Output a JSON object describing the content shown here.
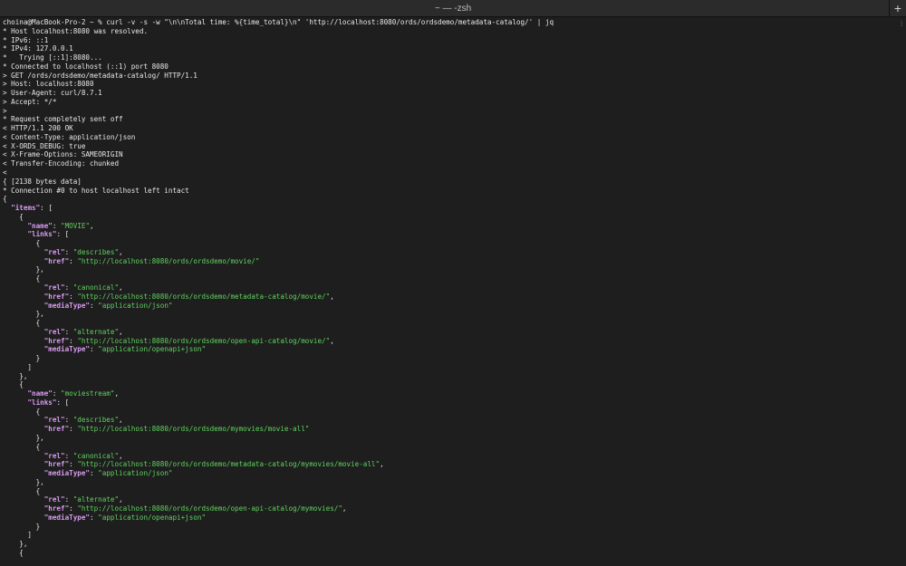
{
  "window": {
    "title": "~ — -zsh",
    "new_tab_symbol": "+"
  },
  "terminal": {
    "lines": [
      "choina@MacBook-Pro-2 ~ % curl -v -s -w \"\\n\\nTotal time: %{time_total}\\n\" 'http://localhost:8080/ords/ordsdemo/metadata-catalog/' | jq",
      "* Host localhost:8080 was resolved.",
      "* IPv6: ::1",
      "* IPv4: 127.0.0.1",
      "*   Trying [::1]:8080...",
      "* Connected to localhost (::1) port 8080",
      "> GET /ords/ordsdemo/metadata-catalog/ HTTP/1.1",
      "> Host: localhost:8080",
      "> User-Agent: curl/8.7.1",
      "> Accept: */*",
      ">",
      "* Request completely sent off",
      "< HTTP/1.1 200 OK",
      "< Content-Type: application/json",
      "< X-ORDS_DEBUG: true",
      "< X-Frame-Options: SAMEORIGIN",
      "< Transfer-Encoding: chunked",
      "<",
      "{ [2138 bytes data]",
      "* Connection #0 to host localhost left intact",
      [
        [
          "{",
          "p"
        ]
      ],
      [
        [
          "  ",
          "p"
        ],
        [
          "\"items\"",
          "k"
        ],
        [
          ": [",
          "p"
        ]
      ],
      [
        [
          "    {",
          "p"
        ]
      ],
      [
        [
          "      ",
          "p"
        ],
        [
          "\"name\"",
          "k"
        ],
        [
          ": ",
          "p"
        ],
        [
          "\"MOVIE\"",
          "s"
        ],
        [
          ",",
          "p"
        ]
      ],
      [
        [
          "      ",
          "p"
        ],
        [
          "\"links\"",
          "k"
        ],
        [
          ": [",
          "p"
        ]
      ],
      [
        [
          "        {",
          "p"
        ]
      ],
      [
        [
          "          ",
          "p"
        ],
        [
          "\"rel\"",
          "k"
        ],
        [
          ": ",
          "p"
        ],
        [
          "\"describes\"",
          "s"
        ],
        [
          ",",
          "p"
        ]
      ],
      [
        [
          "          ",
          "p"
        ],
        [
          "\"href\"",
          "k"
        ],
        [
          ": ",
          "p"
        ],
        [
          "\"http://localhost:8080/ords/ordsdemo/movie/\"",
          "s"
        ]
      ],
      [
        [
          "        },",
          "p"
        ]
      ],
      [
        [
          "        {",
          "p"
        ]
      ],
      [
        [
          "          ",
          "p"
        ],
        [
          "\"rel\"",
          "k"
        ],
        [
          ": ",
          "p"
        ],
        [
          "\"canonical\"",
          "s"
        ],
        [
          ",",
          "p"
        ]
      ],
      [
        [
          "          ",
          "p"
        ],
        [
          "\"href\"",
          "k"
        ],
        [
          ": ",
          "p"
        ],
        [
          "\"http://localhost:8080/ords/ordsdemo/metadata-catalog/movie/\"",
          "s"
        ],
        [
          ",",
          "p"
        ]
      ],
      [
        [
          "          ",
          "p"
        ],
        [
          "\"mediaType\"",
          "k"
        ],
        [
          ": ",
          "p"
        ],
        [
          "\"application/json\"",
          "s"
        ]
      ],
      [
        [
          "        },",
          "p"
        ]
      ],
      [
        [
          "        {",
          "p"
        ]
      ],
      [
        [
          "          ",
          "p"
        ],
        [
          "\"rel\"",
          "k"
        ],
        [
          ": ",
          "p"
        ],
        [
          "\"alternate\"",
          "s"
        ],
        [
          ",",
          "p"
        ]
      ],
      [
        [
          "          ",
          "p"
        ],
        [
          "\"href\"",
          "k"
        ],
        [
          ": ",
          "p"
        ],
        [
          "\"http://localhost:8080/ords/ordsdemo/open-api-catalog/movie/\"",
          "s"
        ],
        [
          ",",
          "p"
        ]
      ],
      [
        [
          "          ",
          "p"
        ],
        [
          "\"mediaType\"",
          "k"
        ],
        [
          ": ",
          "p"
        ],
        [
          "\"application/openapi+json\"",
          "s"
        ]
      ],
      [
        [
          "        }",
          "p"
        ]
      ],
      [
        [
          "      ]",
          "p"
        ]
      ],
      [
        [
          "    },",
          "p"
        ]
      ],
      [
        [
          "    {",
          "p"
        ]
      ],
      [
        [
          "      ",
          "p"
        ],
        [
          "\"name\"",
          "k"
        ],
        [
          ": ",
          "p"
        ],
        [
          "\"moviestream\"",
          "s"
        ],
        [
          ",",
          "p"
        ]
      ],
      [
        [
          "      ",
          "p"
        ],
        [
          "\"links\"",
          "k"
        ],
        [
          ": [",
          "p"
        ]
      ],
      [
        [
          "        {",
          "p"
        ]
      ],
      [
        [
          "          ",
          "p"
        ],
        [
          "\"rel\"",
          "k"
        ],
        [
          ": ",
          "p"
        ],
        [
          "\"describes\"",
          "s"
        ],
        [
          ",",
          "p"
        ]
      ],
      [
        [
          "          ",
          "p"
        ],
        [
          "\"href\"",
          "k"
        ],
        [
          ": ",
          "p"
        ],
        [
          "\"http://localhost:8080/ords/ordsdemo/mymovies/movie-all\"",
          "s"
        ]
      ],
      [
        [
          "        },",
          "p"
        ]
      ],
      [
        [
          "        {",
          "p"
        ]
      ],
      [
        [
          "          ",
          "p"
        ],
        [
          "\"rel\"",
          "k"
        ],
        [
          ": ",
          "p"
        ],
        [
          "\"canonical\"",
          "s"
        ],
        [
          ",",
          "p"
        ]
      ],
      [
        [
          "          ",
          "p"
        ],
        [
          "\"href\"",
          "k"
        ],
        [
          ": ",
          "p"
        ],
        [
          "\"http://localhost:8080/ords/ordsdemo/metadata-catalog/mymovies/movie-all\"",
          "s"
        ],
        [
          ",",
          "p"
        ]
      ],
      [
        [
          "          ",
          "p"
        ],
        [
          "\"mediaType\"",
          "k"
        ],
        [
          ": ",
          "p"
        ],
        [
          "\"application/json\"",
          "s"
        ]
      ],
      [
        [
          "        },",
          "p"
        ]
      ],
      [
        [
          "        {",
          "p"
        ]
      ],
      [
        [
          "          ",
          "p"
        ],
        [
          "\"rel\"",
          "k"
        ],
        [
          ": ",
          "p"
        ],
        [
          "\"alternate\"",
          "s"
        ],
        [
          ",",
          "p"
        ]
      ],
      [
        [
          "          ",
          "p"
        ],
        [
          "\"href\"",
          "k"
        ],
        [
          ": ",
          "p"
        ],
        [
          "\"http://localhost:8080/ords/ordsdemo/open-api-catalog/mymovies/\"",
          "s"
        ],
        [
          ",",
          "p"
        ]
      ],
      [
        [
          "          ",
          "p"
        ],
        [
          "\"mediaType\"",
          "k"
        ],
        [
          ": ",
          "p"
        ],
        [
          "\"application/openapi+json\"",
          "s"
        ]
      ],
      [
        [
          "        }",
          "p"
        ]
      ],
      [
        [
          "      ]",
          "p"
        ]
      ],
      [
        [
          "    },",
          "p"
        ]
      ],
      [
        [
          "    {",
          "p"
        ]
      ]
    ]
  },
  "colors": {
    "background": "#1e1e1e",
    "text": "#e8e8e8",
    "json_key": "#d89bf0",
    "json_string": "#5fd35f"
  }
}
